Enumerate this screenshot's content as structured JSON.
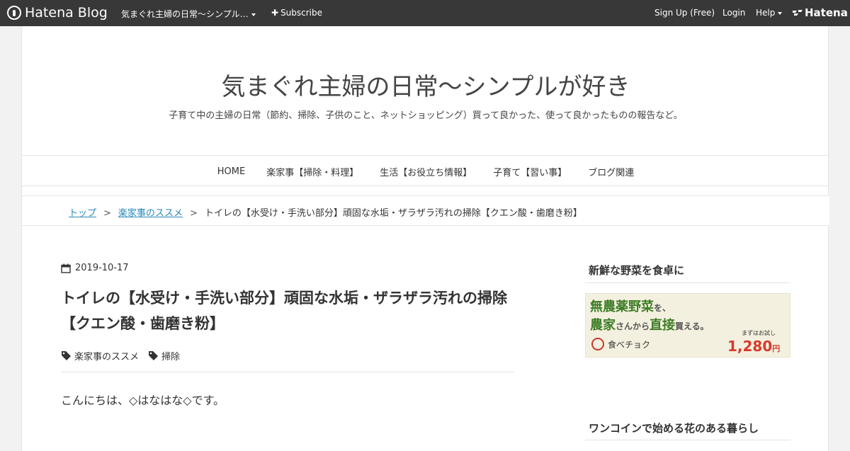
{
  "topbar": {
    "logo_text": "Hatena Blog",
    "blog_selector": "気まぐれ主婦の日常～シンプル…",
    "subscribe": "Subscribe",
    "signup": "Sign Up (Free)",
    "login": "Login",
    "help": "Help",
    "hatena": "Hatena"
  },
  "blog": {
    "title": "気まぐれ主婦の日常～シンプルが好き",
    "description": "子育て中の主婦の日常（節約、掃除、子供のこと、ネットショッピング）買って良かった、使って良かったものの報告など。"
  },
  "nav": {
    "items": [
      "HOME",
      "楽家事【掃除・料理】",
      "生活【お役立ち情報】",
      "子育て【習い事】",
      "ブログ関連"
    ]
  },
  "breadcrumb": {
    "top": "トップ",
    "category": "楽家事のススメ",
    "current": "トイレの【水受け・手洗い部分】頑固な水垢・ザラザラ汚れの掃除【クエン酸・歯磨き粉】",
    "separator": ">"
  },
  "article": {
    "date": "2019-10-17",
    "title": "トイレの【水受け・手洗い部分】頑固な水垢・ザラザラ汚れの掃除【クエン酸・歯磨き粉】",
    "categories": [
      "楽家事のススメ",
      "掃除"
    ],
    "first_line": "こんにちは、◇はなはな◇です。"
  },
  "sidebar": {
    "module1_title": "新鮮な野菜を食卓に",
    "banner": {
      "line1_a": "無農薬野菜",
      "line1_b": "を、",
      "line2_a": "農家",
      "line2_b": "さんから",
      "line2_c": "直接",
      "line2_d": "買える。",
      "brand": "食べチョク",
      "note": "まずはお試し",
      "price": "1,280",
      "price_unit": "円"
    },
    "module2_title": "ワンコインで始める花のある暮らし"
  },
  "colors": {
    "topbar_bg": "#383838",
    "link": "#2a89b6"
  }
}
